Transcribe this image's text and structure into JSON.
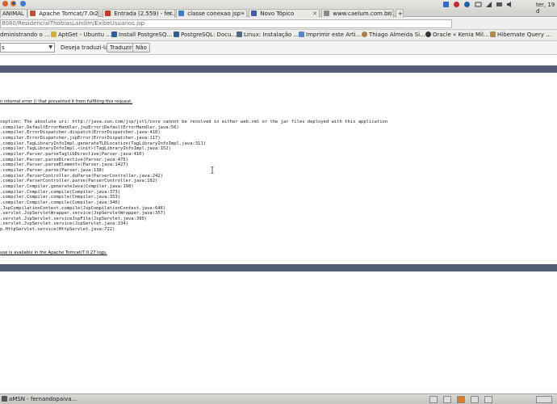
{
  "tabs": [
    {
      "label": "ANIMAL",
      "color": "#6a8f3c"
    },
    {
      "label": "Apache Tomcat/7.0.2...",
      "color": "#c8502f"
    },
    {
      "label": "Entrada (2.559) - fer...",
      "color": "#c23b2b"
    },
    {
      "label": "classe conexao jsp - P...",
      "color": "#3e7bd9"
    },
    {
      "label": "Novo Tópico",
      "color": "#3b5ea8"
    },
    {
      "label": "www.caelum.com.br/...",
      "color": "#8a8a8a"
    }
  ],
  "tray": {
    "clock": "ter, 19 d"
  },
  "address": {
    "url": "8080/ResidencialThobiasLandim/ExibeUsuarios.jsp"
  },
  "bookmarks": [
    {
      "label": "dministrando o ...",
      "color": "#c5732a"
    },
    {
      "label": "AptGet - Ubuntu ...",
      "color": "#d2b12c"
    },
    {
      "label": "Install PostgreSQ...",
      "color": "#2d5e98"
    },
    {
      "label": "PostgreSQL: Docu...",
      "color": "#2d5e98"
    },
    {
      "label": "Linux: Instalação ...",
      "color": "#4a6b8a"
    },
    {
      "label": "Imprimir este Arti...",
      "color": "#5b87c9"
    },
    {
      "label": "Thiago Almeida Si...",
      "color": "#b07a4a"
    },
    {
      "label": "Oracle « Kenia Mil...",
      "color": "#333333"
    },
    {
      "label": "Hibernate Query ...",
      "color": "#b08a4a"
    }
  ],
  "translate": {
    "language": "s",
    "question": "Deseja traduzi-la?",
    "translate_button": "Traduzir",
    "no_button": "Não"
  },
  "page": {
    "message": "n internal error () that prevented it from fulfilling this request.",
    "exception_lines": [
      "ception: The absolute uri: http://java.sun.com/jsp/jstl/core cannot be resolved in either web.xml or the jar files deployed with this application",
      ".compiler.DefaultErrorHandler.jspError(DefaultErrorHandler.java:56)",
      ".compiler.ErrorDispatcher.dispatch(ErrorDispatcher.java:410)",
      ".compiler.ErrorDispatcher.jspError(ErrorDispatcher.java:117)",
      ".compiler.TagLibraryInfoImpl.generateTLDLocation(TagLibraryInfoImpl.java:311)",
      ".compiler.TagLibraryInfoImpl.<init>(TagLibraryInfoImpl.java:152)",
      ".compiler.Parser.parseTaglibDirective(Parser.java:410)",
      ".compiler.Parser.parseDirective(Parser.java:475)",
      ".compiler.Parser.parseElements(Parser.java:1427)",
      ".compiler.Parser.parse(Parser.java:138)",
      ".compiler.ParserController.doParse(ParserController.java:242)",
      ".compiler.ParserController.parse(ParserController.java:102)",
      ".compiler.Compiler.generateJava(Compiler.java:198)",
      ".compiler.Compiler.compile(Compiler.java:373)",
      ".compiler.Compiler.compile(Compiler.java:353)",
      ".compiler.Compiler.compile(Compiler.java:340)",
      ".JspCompilationContext.compile(JspCompilationContext.java:646)",
      ".servlet.JspServletWrapper.service(JspServletWrapper.java:357)",
      ".servlet.JspServlet.serviceJspFile(JspServlet.java:390)",
      ".servlet.JspServlet.service(JspServlet.java:334)",
      "p.HttpServlet.service(HttpServlet.java:722)"
    ],
    "root_cause_note": "use is available in the Apache Tomcat/7.0.27 logs."
  },
  "taskbar": {
    "item": "aMSN - fernandopaiva..."
  }
}
